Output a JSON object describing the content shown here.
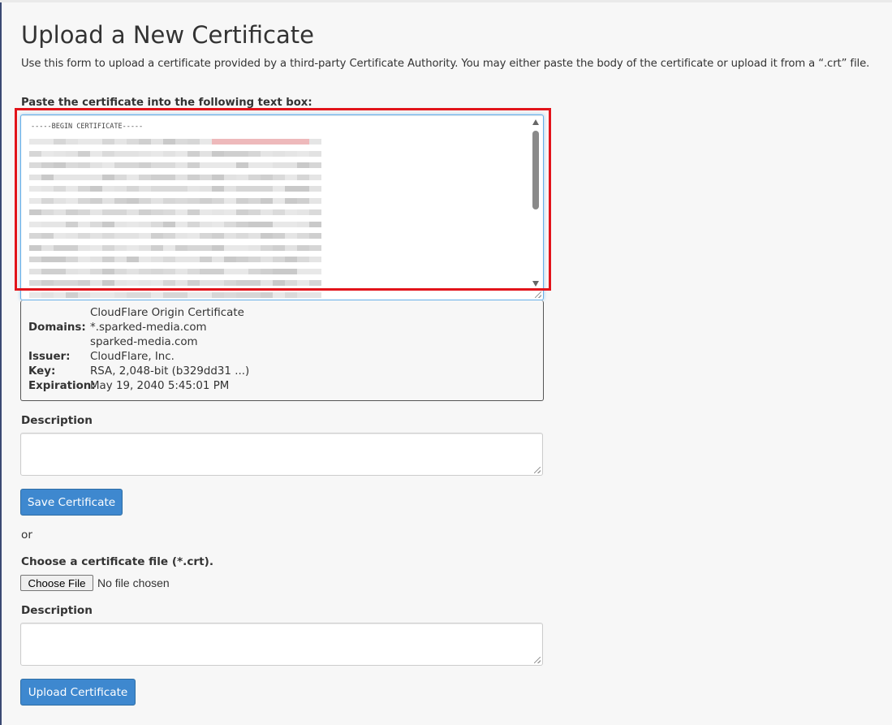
{
  "page": {
    "title": "Upload a New Certificate",
    "intro": "Use this form to upload a certificate provided by a third-party Certificate Authority. You may either paste the body of the certificate or upload it from a “.crt” file."
  },
  "paste_section": {
    "label": "Paste the certificate into the following text box:",
    "certificate_begin": "-----BEGIN CERTIFICATE-----"
  },
  "certificate_details": {
    "name": "CloudFlare Origin Certificate",
    "domains_label": "Domains:",
    "domains": [
      "*.sparked-media.com",
      "sparked-media.com"
    ],
    "issuer_label": "Issuer:",
    "issuer": "CloudFlare, Inc.",
    "key_label": "Key:",
    "key": "RSA, 2,048-bit (b329dd31 ...)",
    "expiration_label": "Expiration:",
    "expiration": "May 19, 2040 5:45:01 PM"
  },
  "description_label_1": "Description",
  "save_button": "Save Certificate",
  "or_text": "or",
  "file_section": {
    "label": "Choose a certificate file (*.crt).",
    "choose_button": "Choose File",
    "status": "No file chosen"
  },
  "description_label_2": "Description",
  "upload_button": "Upload Certificate",
  "colors": {
    "primary_button": "#3e88cf",
    "highlight_frame": "#e2141b",
    "focus_border": "#66afe9"
  }
}
